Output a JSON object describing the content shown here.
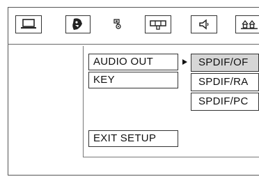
{
  "toolbar": {
    "icons": [
      "system-setup-icon",
      "language-setup-icon",
      "video-setup-icon",
      "speaker-setup-icon",
      "audio-setup-icon",
      "preference-setup-icon"
    ]
  },
  "menu": {
    "items": [
      {
        "label": "AUDIO OUT"
      },
      {
        "label": "KEY"
      },
      {
        "label": "EXIT SETUP"
      }
    ],
    "active_item": "AUDIO OUT",
    "options": [
      {
        "label": "SPDIF/OF",
        "selected": true
      },
      {
        "label": "SPDIF/RA",
        "selected": false
      },
      {
        "label": "SPDIF/PC",
        "selected": false
      }
    ]
  }
}
